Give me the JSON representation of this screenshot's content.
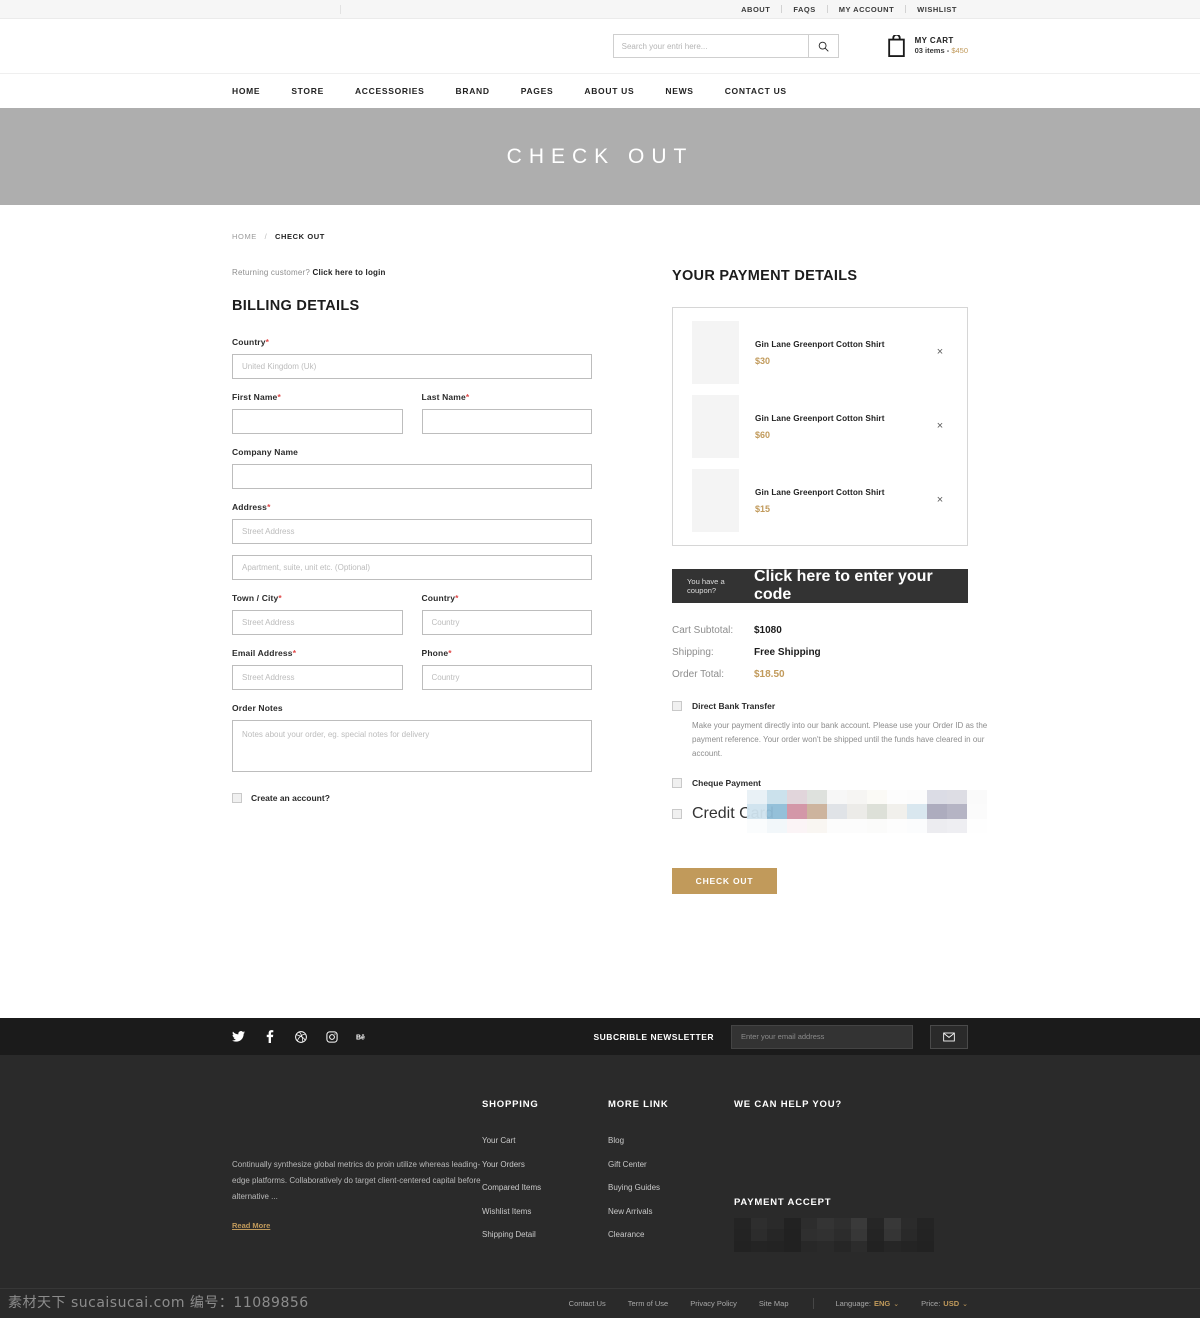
{
  "topbar": {
    "links": [
      "ABOUT",
      "FAQS",
      "MY ACCOUNT",
      "WISHLIST"
    ]
  },
  "header": {
    "search": {
      "placeholder": "Search your entri here...",
      "value": "",
      "icon": "search-icon"
    },
    "cart": {
      "title": "MY CART",
      "items": "03 items -",
      "amount": "$450",
      "icon": "shopping-bag-icon"
    }
  },
  "nav": {
    "items": [
      "HOME",
      "STORE",
      "ACCESSORIES",
      "BRAND",
      "PAGES",
      "ABOUT US",
      "NEWS",
      "CONTACT US"
    ]
  },
  "banner": {
    "title": "CHECK OUT",
    "bg": "#aeaeae"
  },
  "breadcrumb": {
    "home": "HOME",
    "sep": "/",
    "current": "CHECK OUT"
  },
  "billing": {
    "returning_prefix": "Returning customer? ",
    "returning_link": "Click here to login",
    "title": "BILLING DETAILS",
    "fields": {
      "country_label": "Country",
      "country_placeholder": "United Kingdom (Uk)",
      "first_name_label": "First Name",
      "first_name_value": "",
      "last_name_label": "Last Name",
      "last_name_value": "",
      "company_label": "Company Name",
      "company_value": "",
      "address_label": "Address",
      "address_placeholder": "Street Address",
      "address2_placeholder": "Apartment, suite, unit etc. (Optional)",
      "town_label": "Town / City",
      "town_placeholder": "Street Address",
      "country2_label": "Country",
      "country2_placeholder": "Country",
      "email_label": "Email Address",
      "email_placeholder": "Street Address",
      "phone_label": "Phone",
      "phone_placeholder": "Country",
      "notes_label": "Order Notes",
      "notes_placeholder": "Notes about your order, eg. special notes for delivery",
      "create_account": "Create an account?"
    }
  },
  "payment": {
    "title": "YOUR PAYMENT DETAILS",
    "items": [
      {
        "name": "Gin Lane Greenport Cotton Shirt",
        "price": "$30",
        "remove": "×"
      },
      {
        "name": "Gin Lane Greenport Cotton Shirt",
        "price": "$60",
        "remove": "×"
      },
      {
        "name": "Gin Lane Greenport Cotton Shirt",
        "price": "$15",
        "remove": "×"
      }
    ],
    "coupon_prefix": "You have a coupon? ",
    "coupon_link": "Click here to enter your code",
    "totals": [
      {
        "label": "Cart Subtotal:",
        "value": "$1080",
        "gold": false
      },
      {
        "label": "Shipping:",
        "value": "Free Shipping",
        "gold": false
      },
      {
        "label": "Order Total:",
        "value": "$18.50",
        "gold": true
      }
    ],
    "methods": {
      "bank_label": "Direct Bank Transfer",
      "bank_desc": "Make your payment directly into our bank account. Please use your Order ID as the payment reference. Your order won't be shipped until the funds have cleared in our account.",
      "cheque_label": "Cheque Payment",
      "credit_label": "Credit Card"
    },
    "checkout_button": "CHECK OUT",
    "accent": "#c19a5b"
  },
  "footer": {
    "socials": [
      "twitter-icon",
      "facebook-icon",
      "dribbble-icon",
      "instagram-icon",
      "behance-icon"
    ],
    "newsletter": {
      "label": "SUBCRIBLE NEWSLETTER",
      "placeholder": "Enter your email address",
      "value": "",
      "button_icon": "envelope-icon"
    },
    "about_text": "Continually synthesize global metrics do proin utilize whereas leading-edge platforms. Collaboratively do target client-centered capital before alternative ...",
    "read_more": "Read More",
    "columns": [
      {
        "head": "SHOPPING",
        "links": [
          "Your Cart",
          "Your Orders",
          "Compared Items",
          "Wishlist Items",
          "Shipping Detail"
        ]
      },
      {
        "head": "MORE LINK",
        "links": [
          "Blog",
          "Gift Center",
          "Buying Guides",
          "New Arrivals",
          "Clearance"
        ]
      }
    ],
    "help_head": "WE CAN HELP YOU?",
    "payment_accept_head": "PAYMENT ACCEPT",
    "bottom_links": [
      "Contact Us",
      "Term of Use",
      "Privacy Policy",
      "Site Map"
    ],
    "language_label": "Language:",
    "language_value": "ENG",
    "price_label": "Price:",
    "price_value": "USD"
  },
  "watermark": "素材天下 sucaisucai.com  编号：11089856"
}
